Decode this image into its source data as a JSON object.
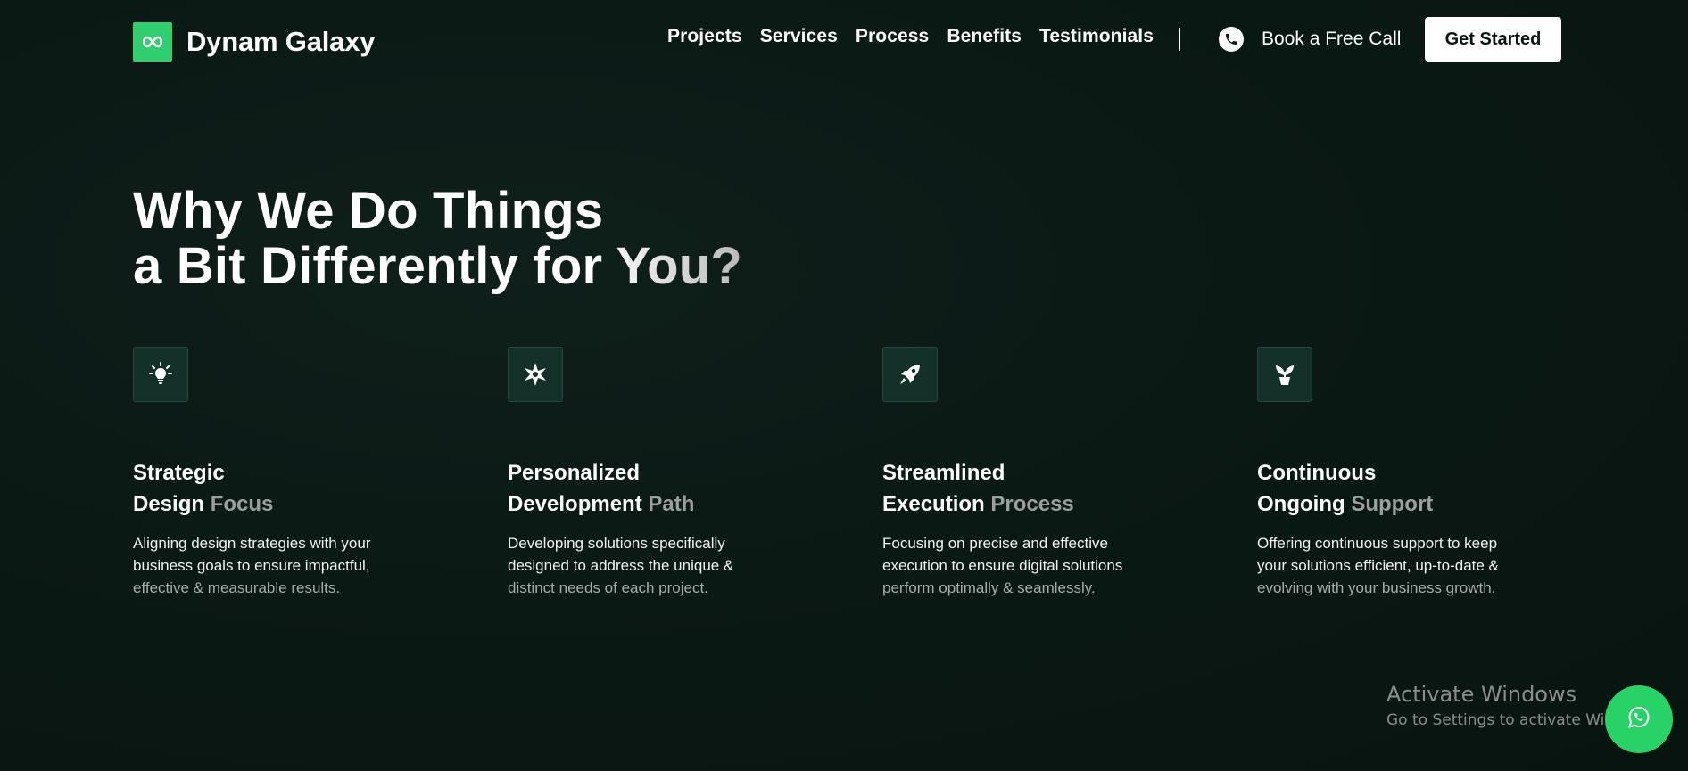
{
  "brand": {
    "name": "Dynam Galaxy",
    "logo_icon": "infinity-icon",
    "accent_color": "#2fcf6f"
  },
  "nav": {
    "links": [
      "Projects",
      "Services",
      "Process",
      "Benefits",
      "Testimonials"
    ],
    "call_label": "Book a Free Call",
    "call_icon": "phone-icon",
    "cta_label": "Get Started"
  },
  "hero": {
    "line1": "Why We Do Things",
    "line2": "a Bit Differently for You?"
  },
  "features": [
    {
      "icon": "lightbulb-icon",
      "title_line1": "Strategic",
      "title_line2_main": "Design ",
      "title_line2_accent": "Focus",
      "desc_line1": "Aligning design strategies with your",
      "desc_line2": "business goals to ensure impactful,",
      "desc_line3": "effective & measurable results."
    },
    {
      "icon": "compass-star-icon",
      "title_line1": "Personalized",
      "title_line2_main": "Development ",
      "title_line2_accent": "Path",
      "desc_line1": "Developing solutions specifically",
      "desc_line2": "designed to address the unique &",
      "desc_line3": "distinct needs of each project."
    },
    {
      "icon": "rocket-icon",
      "title_line1": "Streamlined",
      "title_line2_main": "Execution ",
      "title_line2_accent": "Process",
      "desc_line1": "Focusing on precise and effective",
      "desc_line2": "execution to ensure digital solutions",
      "desc_line3": "perform optimally & seamlessly."
    },
    {
      "icon": "plant-pot-icon",
      "title_line1": "Continuous",
      "title_line2_main": "Ongoing ",
      "title_line2_accent": "Support",
      "desc_line1": "Offering continuous support to keep",
      "desc_line2": "your solutions efficient, up-to-date &",
      "desc_line3": "evolving with your business growth."
    }
  ],
  "watermark": {
    "title": "Activate Windows",
    "subtitle": "Go to Settings to activate Windows."
  },
  "whatsapp": {
    "icon": "whatsapp-icon",
    "color": "#27d367"
  }
}
